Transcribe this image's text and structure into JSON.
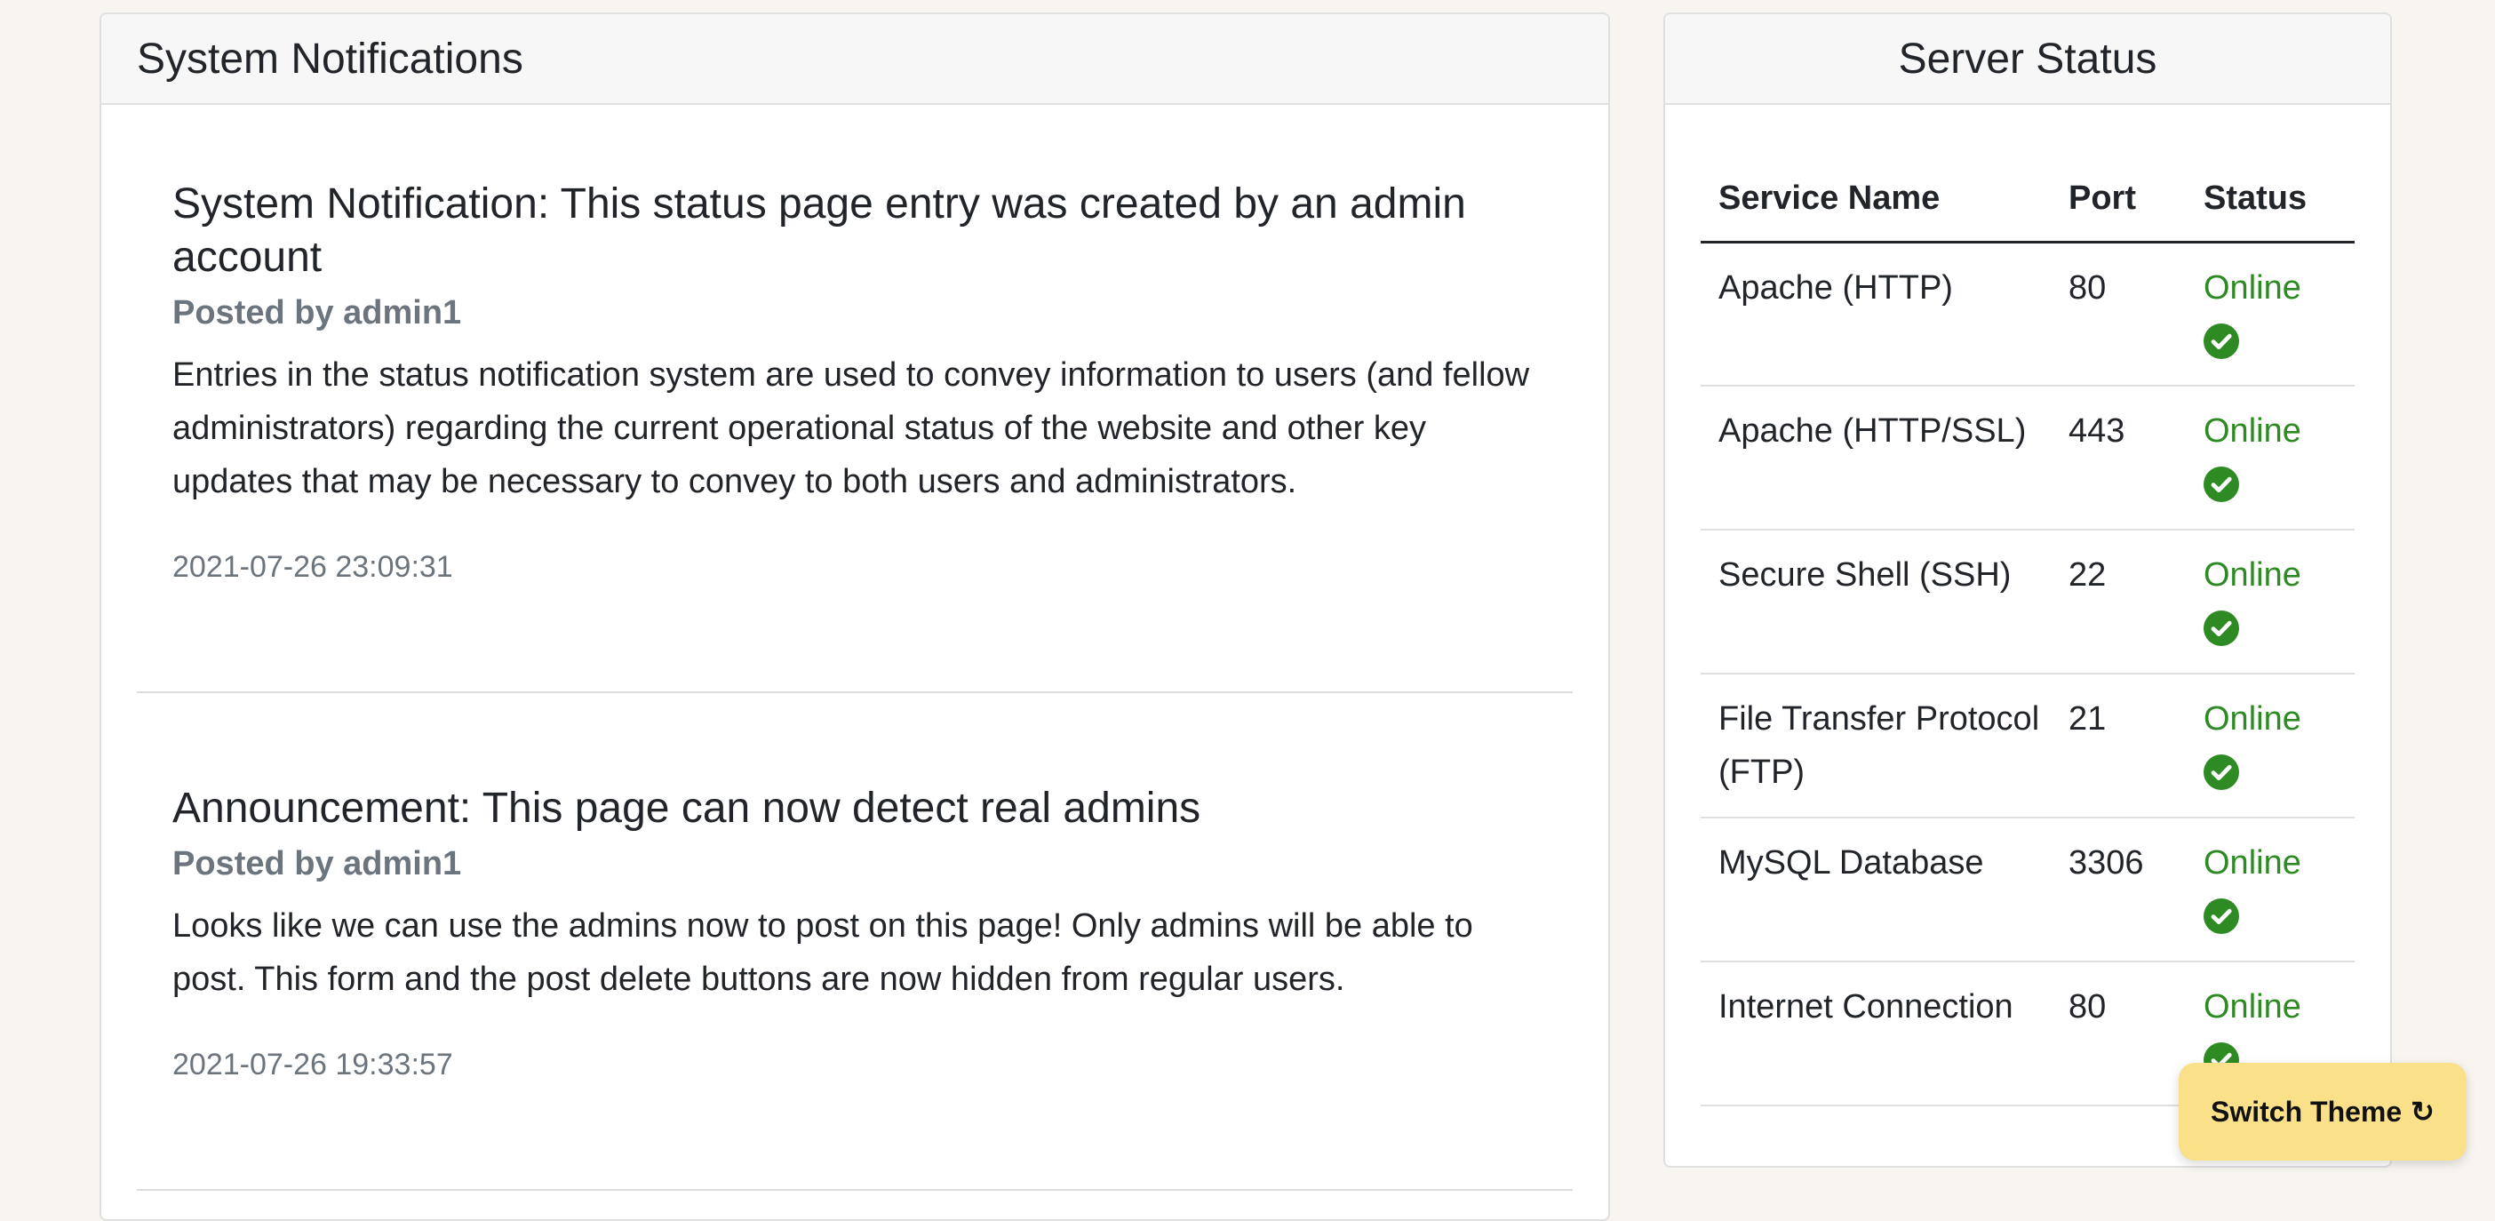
{
  "notifications": {
    "header": "System Notifications",
    "entries": [
      {
        "title": "System Notification: This status page entry was created by an admin account",
        "author": "Posted by admin1",
        "body": "Entries in the status notification system are used to convey information to users (and fellow administrators) regarding the current operational status of the website and other key updates that may be necessary to convey to both users and administrators.",
        "date": "2021-07-26 23:09:31"
      },
      {
        "title": "Announcement: This page can now detect real admins",
        "author": "Posted by admin1",
        "body": "Looks like we can use the admins now to post on this page! Only admins will be able to post. This form and the post delete buttons are now hidden from regular users.",
        "date": "2021-07-26 19:33:57"
      }
    ]
  },
  "server_status": {
    "header": "Server Status",
    "columns": [
      "Service Name",
      "Port",
      "Status"
    ],
    "rows": [
      {
        "service": "Apache (HTTP)",
        "port": "80",
        "status": "Online"
      },
      {
        "service": "Apache (HTTP/SSL)",
        "port": "443",
        "status": "Online"
      },
      {
        "service": "Secure Shell (SSH)",
        "port": "22",
        "status": "Online"
      },
      {
        "service": "File Transfer Protocol (FTP)",
        "port": "21",
        "status": "Online"
      },
      {
        "service": "MySQL Database",
        "port": "3306",
        "status": "Online"
      },
      {
        "service": "Internet Connection",
        "port": "80",
        "status": "Online"
      }
    ],
    "status_icon": "check-circle-icon",
    "online_color": "#2e8b23"
  },
  "theme_button": {
    "label": "Switch Theme",
    "icon": "refresh-icon",
    "color": "#fbe08a"
  }
}
